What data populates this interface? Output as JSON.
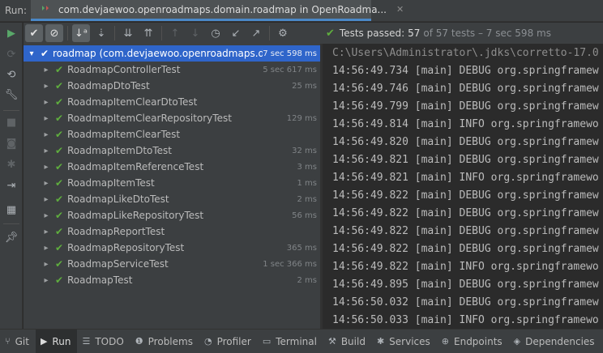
{
  "titlebar": {
    "run_label": "Run:",
    "tab_title": "com.devjaewoo.openroadmaps.domain.roadmap in OpenRoadma..."
  },
  "status": {
    "prefix": "Tests passed:",
    "passed": "57",
    "rest": "of 57 tests – 7 sec 598 ms"
  },
  "tree": {
    "root": {
      "name": "roadmap (com.devjaewoo.openroadmaps.doma",
      "duration": "7 sec 598 ms"
    },
    "items": [
      {
        "name": "RoadmapControllerTest",
        "duration": "5 sec 617 ms"
      },
      {
        "name": "RoadmapDtoTest",
        "duration": "25 ms"
      },
      {
        "name": "RoadmapItemClearDtoTest",
        "duration": ""
      },
      {
        "name": "RoadmapItemClearRepositoryTest",
        "duration": "129 ms"
      },
      {
        "name": "RoadmapItemClearTest",
        "duration": ""
      },
      {
        "name": "RoadmapItemDtoTest",
        "duration": "32 ms"
      },
      {
        "name": "RoadmapItemReferenceTest",
        "duration": "3 ms"
      },
      {
        "name": "RoadmapItemTest",
        "duration": "1 ms"
      },
      {
        "name": "RoadmapLikeDtoTest",
        "duration": "2 ms"
      },
      {
        "name": "RoadmapLikeRepositoryTest",
        "duration": "56 ms"
      },
      {
        "name": "RoadmapReportTest",
        "duration": ""
      },
      {
        "name": "RoadmapRepositoryTest",
        "duration": "365 ms"
      },
      {
        "name": "RoadmapServiceTest",
        "duration": "1 sec 366 ms"
      },
      {
        "name": "RoadmapTest",
        "duration": "2 ms"
      }
    ]
  },
  "console": {
    "lines": [
      "C:\\Users\\Administrator\\.jdks\\corretto-17.0",
      "14:56:49.734 [main] DEBUG org.springframew",
      "14:56:49.746 [main] DEBUG org.springframew",
      "14:56:49.799 [main] DEBUG org.springframew",
      "14:56:49.814 [main] INFO org.springframewo",
      "14:56:49.820 [main] DEBUG org.springframew",
      "14:56:49.821 [main] DEBUG org.springframew",
      "14:56:49.821 [main] INFO org.springframewo",
      "14:56:49.822 [main] DEBUG org.springframew",
      "14:56:49.822 [main] DEBUG org.springframew",
      "14:56:49.822 [main] DEBUG org.springframew",
      "14:56:49.822 [main] DEBUG org.springframew",
      "14:56:49.822 [main] INFO org.springframewo",
      "14:56:49.895 [main] DEBUG org.springframew",
      "14:56:50.032 [main] DEBUG org.springframew",
      "14:56:50.033 [main] INFO org.springframewo"
    ]
  },
  "bottom": {
    "git": "Git",
    "run": "Run",
    "todo": "TODO",
    "problems": "Problems",
    "profiler": "Profiler",
    "terminal": "Terminal",
    "build": "Build",
    "services": "Services",
    "endpoints": "Endpoints",
    "dependencies": "Dependencies"
  },
  "colors": {
    "accent": "#2f65ca",
    "pass": "#5fae3e",
    "panel": "#3c3f41",
    "console_bg": "#2b2b2b"
  }
}
